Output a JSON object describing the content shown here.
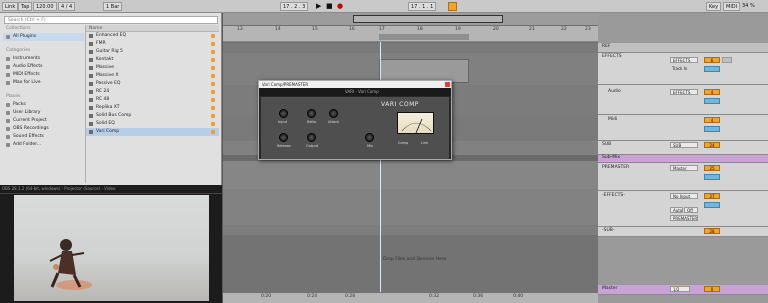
{
  "topbar": {
    "link": "Link",
    "tap": "Tap",
    "tempo": "120.00",
    "time_sig": "4 / 4",
    "metronome": "1 Bar",
    "position": "17 . 2 . 3",
    "loop_start": "17 . 1 . 1",
    "key": "Key",
    "midi": "MIDI",
    "cpu": "34 %"
  },
  "browser": {
    "search_placeholder": "Search (Ctrl + F)",
    "collections_label": "Collections",
    "all_plugins": "All Plugins",
    "categories_label": "Categories",
    "categories": [
      "Instruments",
      "Audio Effects",
      "MIDI Effects",
      "Max for Live"
    ],
    "places_label": "Places",
    "places": [
      "Packs",
      "User Library",
      "Current Project",
      "OBS Recordings",
      "Sound Effects",
      "Add Folder..."
    ],
    "files_header": "Name",
    "files": [
      "Enhanced EQ",
      "FMR",
      "Guitar Rig 5",
      "Kontakt",
      "Massive",
      "Massive X",
      "Passive EQ",
      "RC 24",
      "RC 48",
      "Replika XT",
      "Solid Bus Comp",
      "Solid EQ",
      "Vari Comp"
    ]
  },
  "video": {
    "title": "OBS 28.1.2 (64-bit, windows) - Projector (Source) - Video"
  },
  "arrangement": {
    "ticks": [
      "13",
      "14",
      "15",
      "16",
      "17",
      "18",
      "19",
      "20",
      "21",
      "22",
      "23"
    ],
    "drop_text": "Drop Files and Devices Here",
    "bottom_ticks": [
      "0:20",
      "0:24",
      "0:28",
      "0:32",
      "0:36",
      "0:40"
    ]
  },
  "plugin": {
    "title": "Vari Comp/PREMASTER",
    "header": "VARI - Vari Comp",
    "brand": "VARI COMP",
    "knobs": [
      "Input",
      "Ratio",
      "Attack",
      "Release",
      "Output",
      "Mix"
    ],
    "toggle": "Comp",
    "link": "Link"
  },
  "mixer": {
    "tracks": [
      {
        "name": "REF",
        "route": "",
        "vol": "",
        "pan": ""
      },
      {
        "name": "EFFECTS",
        "route": "EFFECTS",
        "vol": "6",
        "pan": "S"
      },
      {
        "name": "Audio",
        "route": "EFFECTS",
        "vol": "4",
        "pan": "S"
      },
      {
        "name": "Midi",
        "route": "",
        "vol": "4",
        "pan": "S"
      },
      {
        "name": "SUB",
        "route": "SUB",
        "vol": "24",
        "pan": "S"
      },
      {
        "name": "Sub-Mix",
        "route": "",
        "vol": "",
        "pan": ""
      },
      {
        "name": "PREMASTER",
        "route": "Master",
        "vol": "25",
        "pan": "S"
      },
      {
        "name": "-EFFECTS-",
        "route": "No Input",
        "vol": "27",
        "pan": "S"
      },
      {
        "name": "-SUB-",
        "route": "",
        "vol": "28",
        "pan": "S"
      },
      {
        "name": "Master",
        "route": "1/2",
        "vol": "0",
        "pan": ""
      }
    ],
    "auto_label": "Auto",
    "off_label": "Off",
    "track_in": "Track In",
    "premaster_out": "PREMASTER"
  }
}
